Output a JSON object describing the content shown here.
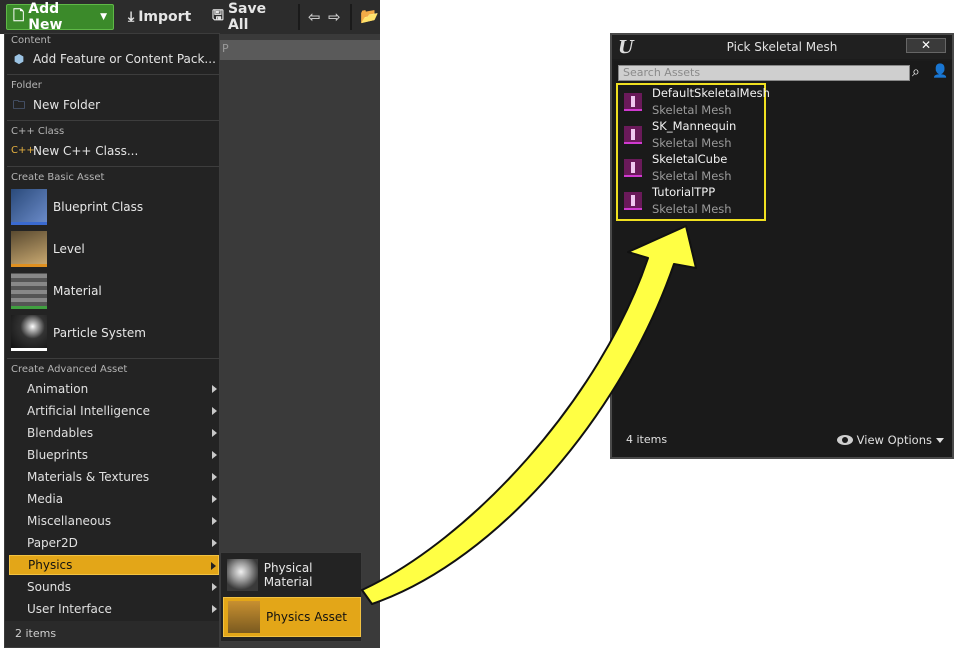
{
  "toolbar": {
    "add_new": "Add New",
    "import": "Import",
    "save_all": "Save All"
  },
  "content_browser": {
    "path_fragment": "P"
  },
  "menu": {
    "sections": {
      "content": "Content",
      "folder": "Folder",
      "cpp": "C++ Class",
      "basic": "Create Basic Asset",
      "advanced": "Create Advanced Asset"
    },
    "add_feature": "Add Feature or Content Pack...",
    "new_folder": "New Folder",
    "new_cpp": "New C++ Class...",
    "basic_assets": [
      "Blueprint Class",
      "Level",
      "Material",
      "Particle System"
    ],
    "advanced_items": [
      "Animation",
      "Artificial Intelligence",
      "Blendables",
      "Blueprints",
      "Materials & Textures",
      "Media",
      "Miscellaneous",
      "Paper2D",
      "Physics",
      "Sounds",
      "User Interface"
    ],
    "selected": "Physics",
    "footer_count": "2 items"
  },
  "physics_submenu": {
    "items": [
      "Physical Material",
      "Physics Asset"
    ],
    "selected": "Physics Asset"
  },
  "dialog": {
    "title": "Pick Skeletal Mesh",
    "close": "✕",
    "search_placeholder": "Search Assets",
    "assets": [
      {
        "name": "DefaultSkeletalMesh",
        "type": "Skeletal Mesh"
      },
      {
        "name": "SK_Mannequin",
        "type": "Skeletal Mesh"
      },
      {
        "name": "SkeletalCube",
        "type": "Skeletal Mesh"
      },
      {
        "name": "TutorialTPP",
        "type": "Skeletal Mesh"
      }
    ],
    "count": "4 items",
    "view_options": "View Options"
  },
  "colors": {
    "accent_selected": "#e3a618",
    "add_new_green": "#3b8a2a",
    "highlight_outline": "#f0e020",
    "arrow_fill": "#ffff44"
  }
}
